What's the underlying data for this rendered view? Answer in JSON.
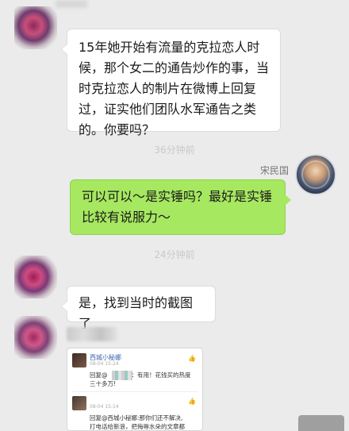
{
  "messages": [
    {
      "side": "left",
      "text": "15年她开始有流量的克拉恋人时候，那个女二的通告炒作的事，当时克拉恋人的制片在微博上回复过，证实他们团队水军通告之类的。你要吗？"
    },
    {
      "side": "right",
      "sender": "宋民国",
      "text": "可以可以～是实锤吗？最好是实锤比较有说服力～"
    },
    {
      "side": "left",
      "text": "是，找到当时的截图了"
    }
  ],
  "timestamps": [
    "36分钟前",
    "24分钟前"
  ],
  "screenshot": {
    "comments": [
      {
        "name": "西城小秘娜",
        "time": "08-04 15:24",
        "line1": "回复@",
        "line1b": "：有用！花钱买的热度",
        "line2": "三十多万!"
      },
      {
        "name": "",
        "time": "08-04 15:14",
        "line1": "回复@西城小秘娜:那你们还不解决,",
        "line1b": "",
        "line2": "打电话给新浪，把侮辱水朵的文章都"
      }
    ],
    "like_icon": "thumb-up-icon"
  },
  "colors": {
    "background": "#ebebeb",
    "incoming_bubble": "#ffffff",
    "outgoing_bubble": "#a6e860"
  }
}
